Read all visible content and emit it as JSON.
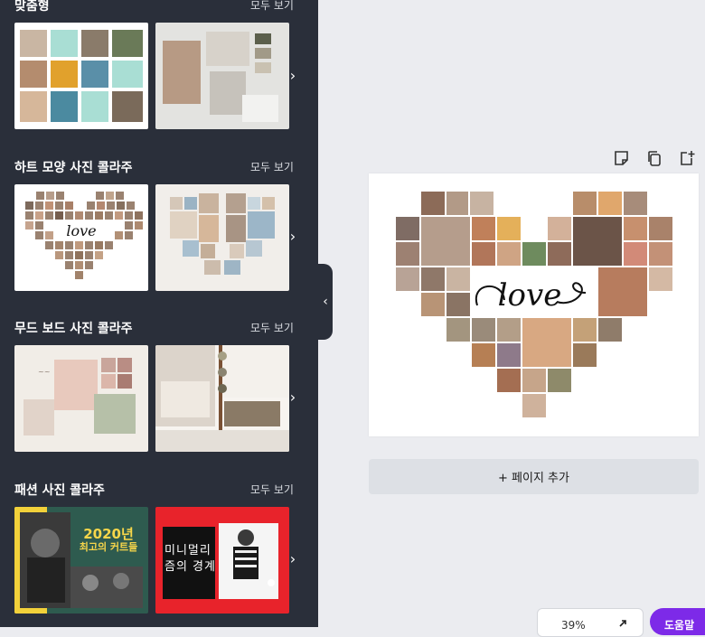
{
  "sidebar": {
    "sections": [
      {
        "title": "맞춤형",
        "see_all": "모두 보기"
      },
      {
        "title": "하트 모양 사진 콜라주",
        "see_all": "모두 보기"
      },
      {
        "title": "무드 보드 사진 콜라주",
        "see_all": "모두 보기"
      },
      {
        "title": "패션 사진 콜라주",
        "see_all": "모두 보기"
      }
    ],
    "fashion_thumb_1": {
      "line1": "2020년",
      "line2": "최고의 커트들"
    },
    "fashion_thumb_2": {
      "line1": "미니멀리",
      "line2": "즘의 경계"
    }
  },
  "canvas": {
    "center_word": "love"
  },
  "add_page": "+ 페이지 추가",
  "zoom": "39%",
  "help": "도움말",
  "colors": {
    "sidebar": "#2a2f3a",
    "workspace": "#ebecf0",
    "accent": "#7d2ae8",
    "fashion_green": "#2e5b4f",
    "fashion_red": "#e8232b"
  }
}
